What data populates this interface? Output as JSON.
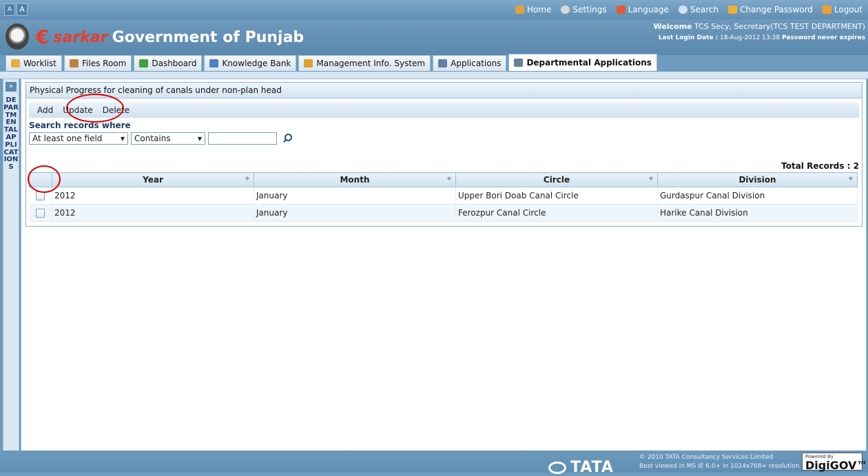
{
  "top_bar": {
    "font_small": "A",
    "font_large": "A",
    "nav": [
      {
        "label": "Home",
        "icon": "home-icon",
        "color": "#e0a040"
      },
      {
        "label": "Settings",
        "icon": "gear-icon",
        "color": "#d8d8d8"
      },
      {
        "label": "Language",
        "icon": "language-icon",
        "color": "#e05a3a"
      },
      {
        "label": "Search",
        "icon": "search-icon",
        "color": "#cfe2f3"
      },
      {
        "label": "Change Password",
        "icon": "key-icon",
        "color": "#f0b030"
      },
      {
        "label": "Logout",
        "icon": "logout-icon",
        "color": "#f0a030"
      }
    ]
  },
  "header": {
    "logo_e": "€",
    "logo_text": "sarkar",
    "title": "Government of Punjab",
    "welcome_label": "Welcome",
    "welcome_user": "TCS Secy, Secretary(TCS TEST DEPARTMENT)",
    "last_login_label": "Last Login Date :",
    "last_login_value": "18-Aug-2012 13:38",
    "password_note": "Password never expires"
  },
  "tabs": [
    {
      "label": "Worklist",
      "icon": "folder-icon",
      "color": "#e0b040"
    },
    {
      "label": "Files Room",
      "icon": "files-icon",
      "color": "#c08040"
    },
    {
      "label": "Dashboard",
      "icon": "chart-icon",
      "color": "#40a040"
    },
    {
      "label": "Knowledge Bank",
      "icon": "book-icon",
      "color": "#5080c0"
    },
    {
      "label": "Management Info. System",
      "icon": "mis-icon",
      "color": "#e0a030"
    },
    {
      "label": "Applications",
      "icon": "app-icon",
      "color": "#6080a0"
    },
    {
      "label": "Departmental Applications",
      "icon": "dept-app-icon",
      "color": "#6080a0",
      "active": true
    }
  ],
  "sidebar": {
    "toggle": "»",
    "vertical_label": "DEPARTMENTAL APPLICATIONS"
  },
  "panel": {
    "title": "Physical Progress for cleaning of canals under non-plan head",
    "toolbar": {
      "add": "Add",
      "update": "Update",
      "delete": "Delete"
    },
    "search": {
      "title": "Search records where",
      "field_select": "At least one field",
      "op_select": "Contains",
      "value": ""
    },
    "total_records": "Total Records : 2",
    "columns": [
      "Year",
      "Month",
      "Circle",
      "Division"
    ],
    "rows": [
      [
        "2012",
        "January",
        "Upper Bori Doab Canal  Circle",
        "Gurdaspur Canal Division"
      ],
      [
        "2012",
        "January",
        "Ferozpur Canal Circle",
        "Harike Canal Division"
      ]
    ]
  },
  "footer": {
    "tata": "TATA",
    "copyright": "© 2010 TATA Consultancy Services Limited",
    "best_viewed": "Best viewed in MS IE 6.0+ in 1024x768+ resolution",
    "powered_by": "Powered By",
    "digigov": "DigiGOV™"
  }
}
